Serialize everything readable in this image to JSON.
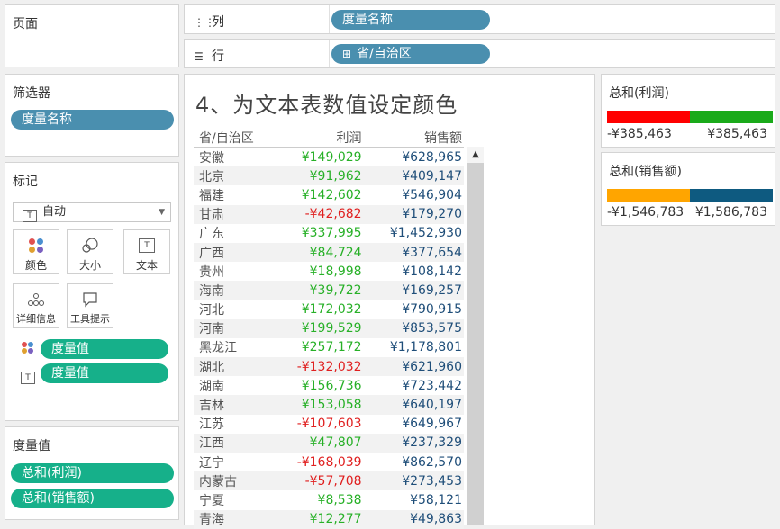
{
  "pages_panel": {
    "title": "页面"
  },
  "columns_shelf": {
    "label": "列",
    "icon": "columns-icon",
    "pill": "度量名称"
  },
  "rows_shelf": {
    "label": "行",
    "icon": "rows-icon",
    "pill": "省/自治区",
    "pill_icon": "⊞"
  },
  "filters_panel": {
    "title": "筛选器",
    "pill": "度量名称"
  },
  "marks_panel": {
    "title": "标记",
    "type_dropdown": "自动",
    "buttons": [
      "颜色",
      "大小",
      "文本",
      "详细信息",
      "工具提示"
    ],
    "pills": [
      "度量值",
      "度量值"
    ]
  },
  "measure_values_panel": {
    "title": "度量值",
    "pills": [
      "总和(利润)",
      "总和(销售额)"
    ]
  },
  "view": {
    "title": "4、为文本表数值设定颜色",
    "headers": [
      "省/自治区",
      "利润",
      "销售额"
    ],
    "rows": [
      [
        "安徽",
        "¥149,029",
        "¥628,965"
      ],
      [
        "北京",
        "¥91,962",
        "¥409,147"
      ],
      [
        "福建",
        "¥142,602",
        "¥546,904"
      ],
      [
        "甘肃",
        "-¥42,682",
        "¥179,270"
      ],
      [
        "广东",
        "¥337,995",
        "¥1,452,930"
      ],
      [
        "广西",
        "¥84,724",
        "¥377,654"
      ],
      [
        "贵州",
        "¥18,998",
        "¥108,142"
      ],
      [
        "海南",
        "¥39,722",
        "¥169,257"
      ],
      [
        "河北",
        "¥172,032",
        "¥790,915"
      ],
      [
        "河南",
        "¥199,529",
        "¥853,575"
      ],
      [
        "黑龙江",
        "¥257,172",
        "¥1,178,801"
      ],
      [
        "湖北",
        "-¥132,032",
        "¥621,960"
      ],
      [
        "湖南",
        "¥156,736",
        "¥723,442"
      ],
      [
        "吉林",
        "¥153,058",
        "¥640,197"
      ],
      [
        "江苏",
        "-¥107,603",
        "¥649,967"
      ],
      [
        "江西",
        "¥47,807",
        "¥237,329"
      ],
      [
        "辽宁",
        "-¥168,039",
        "¥862,570"
      ],
      [
        "内蒙古",
        "-¥57,708",
        "¥273,453"
      ],
      [
        "宁夏",
        "¥8,538",
        "¥58,121"
      ],
      [
        "青海",
        "¥12,277",
        "¥49,863"
      ]
    ]
  },
  "legend_profit": {
    "title": "总和(利润)",
    "min": "-¥385,463",
    "max": "¥385,463",
    "colors": [
      "#ff0000",
      "#1aaa1a"
    ]
  },
  "legend_sales": {
    "title": "总和(销售额)",
    "min": "-¥1,546,783",
    "max": "¥1,586,783",
    "colors": [
      "#ffa500",
      "#0e5a80"
    ]
  },
  "colors": {
    "positive_profit": "#27b027",
    "negative_profit": "#e02020",
    "sales_text": "#1f4e79",
    "pill_blue": "#4a8faf",
    "pill_green": "#16b08a"
  }
}
